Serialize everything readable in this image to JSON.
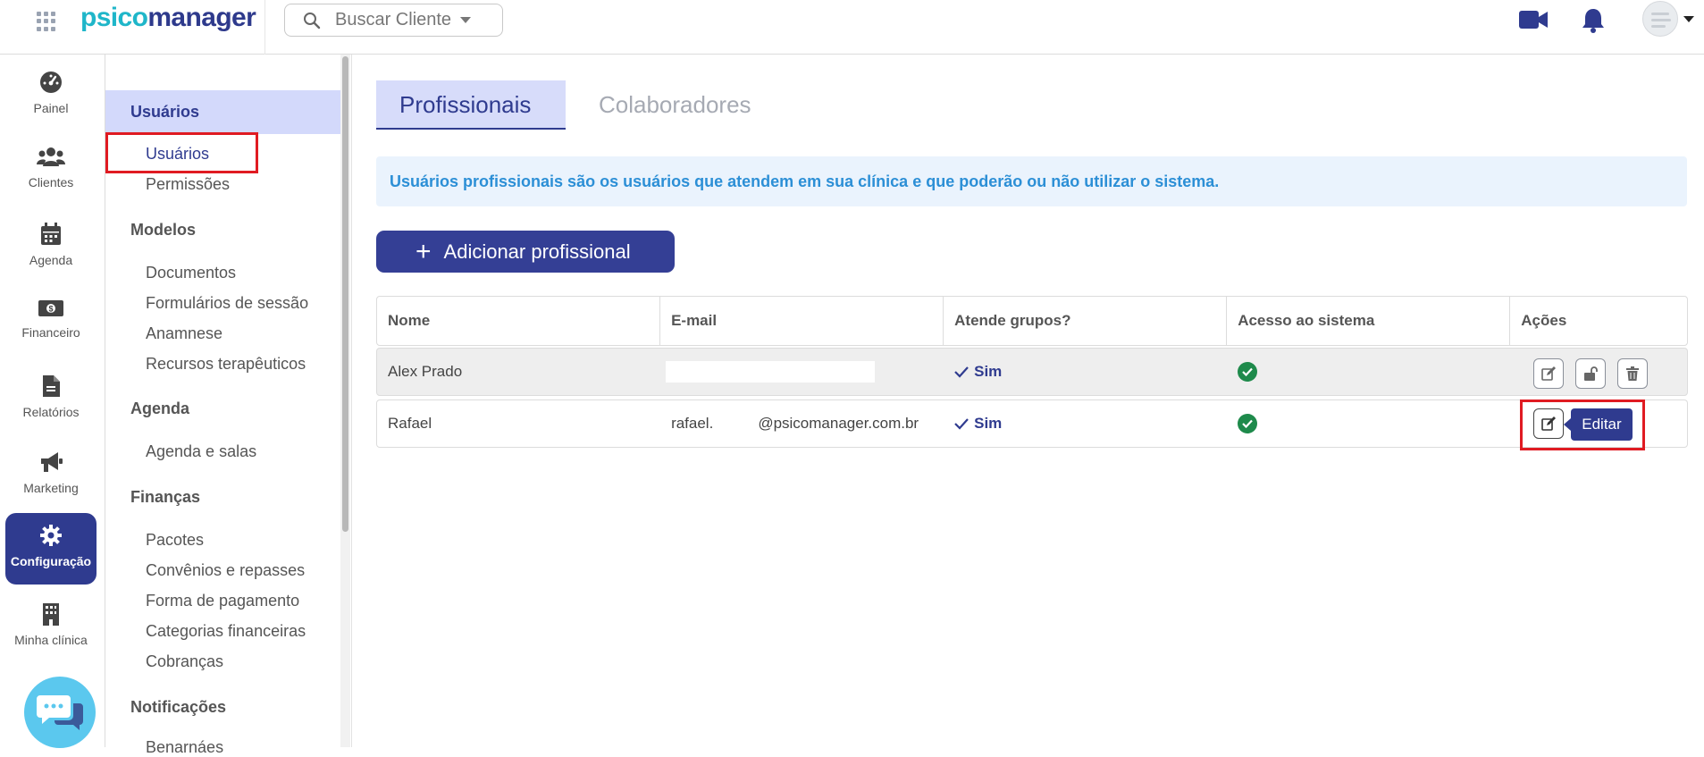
{
  "app": {
    "logo_part1": "psico",
    "logo_part2": "manager"
  },
  "topbar": {
    "search_placeholder": "Buscar Cliente",
    "icons": [
      "apps-grid-icon",
      "search-icon",
      "video-camera-icon",
      "bell-icon",
      "user-avatar"
    ]
  },
  "rail": {
    "items": [
      {
        "label": "Painel",
        "icon": "dashboard-gauge-icon"
      },
      {
        "label": "Clientes",
        "icon": "users-icon"
      },
      {
        "label": "Agenda",
        "icon": "calendar-icon"
      },
      {
        "label": "Financeiro",
        "icon": "money-icon"
      },
      {
        "label": "Relatórios",
        "icon": "document-icon"
      },
      {
        "label": "Marketing",
        "icon": "megaphone-icon"
      },
      {
        "label": "Configuração",
        "icon": "gear-icon",
        "active": true
      },
      {
        "label": "Minha clínica",
        "icon": "building-icon"
      }
    ]
  },
  "submenu": {
    "sections": [
      {
        "title": "Usuários",
        "items": [
          "Usuários",
          "Permissões"
        ]
      },
      {
        "title": "Modelos",
        "items": [
          "Documentos",
          "Formulários de sessão",
          "Anamnese",
          "Recursos terapêuticos"
        ]
      },
      {
        "title": "Agenda",
        "items": [
          "Agenda e salas"
        ]
      },
      {
        "title": "Finanças",
        "items": [
          "Pacotes",
          "Convênios e repasses",
          "Forma de pagamento",
          "Categorias financeiras",
          "Cobranças"
        ]
      },
      {
        "title": "Notificações",
        "items": [
          "Benarnáes"
        ]
      }
    ]
  },
  "main": {
    "tabs": [
      "Profissionais",
      "Colaboradores"
    ],
    "info_banner": "Usuários profissionais são os usuários que atendem em sua clínica e que poderão ou não utilizar o sistema.",
    "add_button": "Adicionar profissional",
    "table": {
      "headers": [
        "Nome",
        "E-mail",
        "Atende grupos?",
        "Acesso ao sistema",
        "Ações"
      ],
      "rows": [
        {
          "name": "Alex Prado",
          "email": "",
          "groups": "Sim",
          "access": true
        },
        {
          "name": "Rafael",
          "email_user": "rafael.",
          "email_domain": "@psicomanager.com.br",
          "groups": "Sim",
          "access": true
        }
      ]
    },
    "tooltip": "Editar"
  },
  "colors": {
    "primary": "#2f3b8f",
    "accent": "#1fb6c9",
    "highlight_red": "#e01b22",
    "success": "#1e8a4b"
  }
}
